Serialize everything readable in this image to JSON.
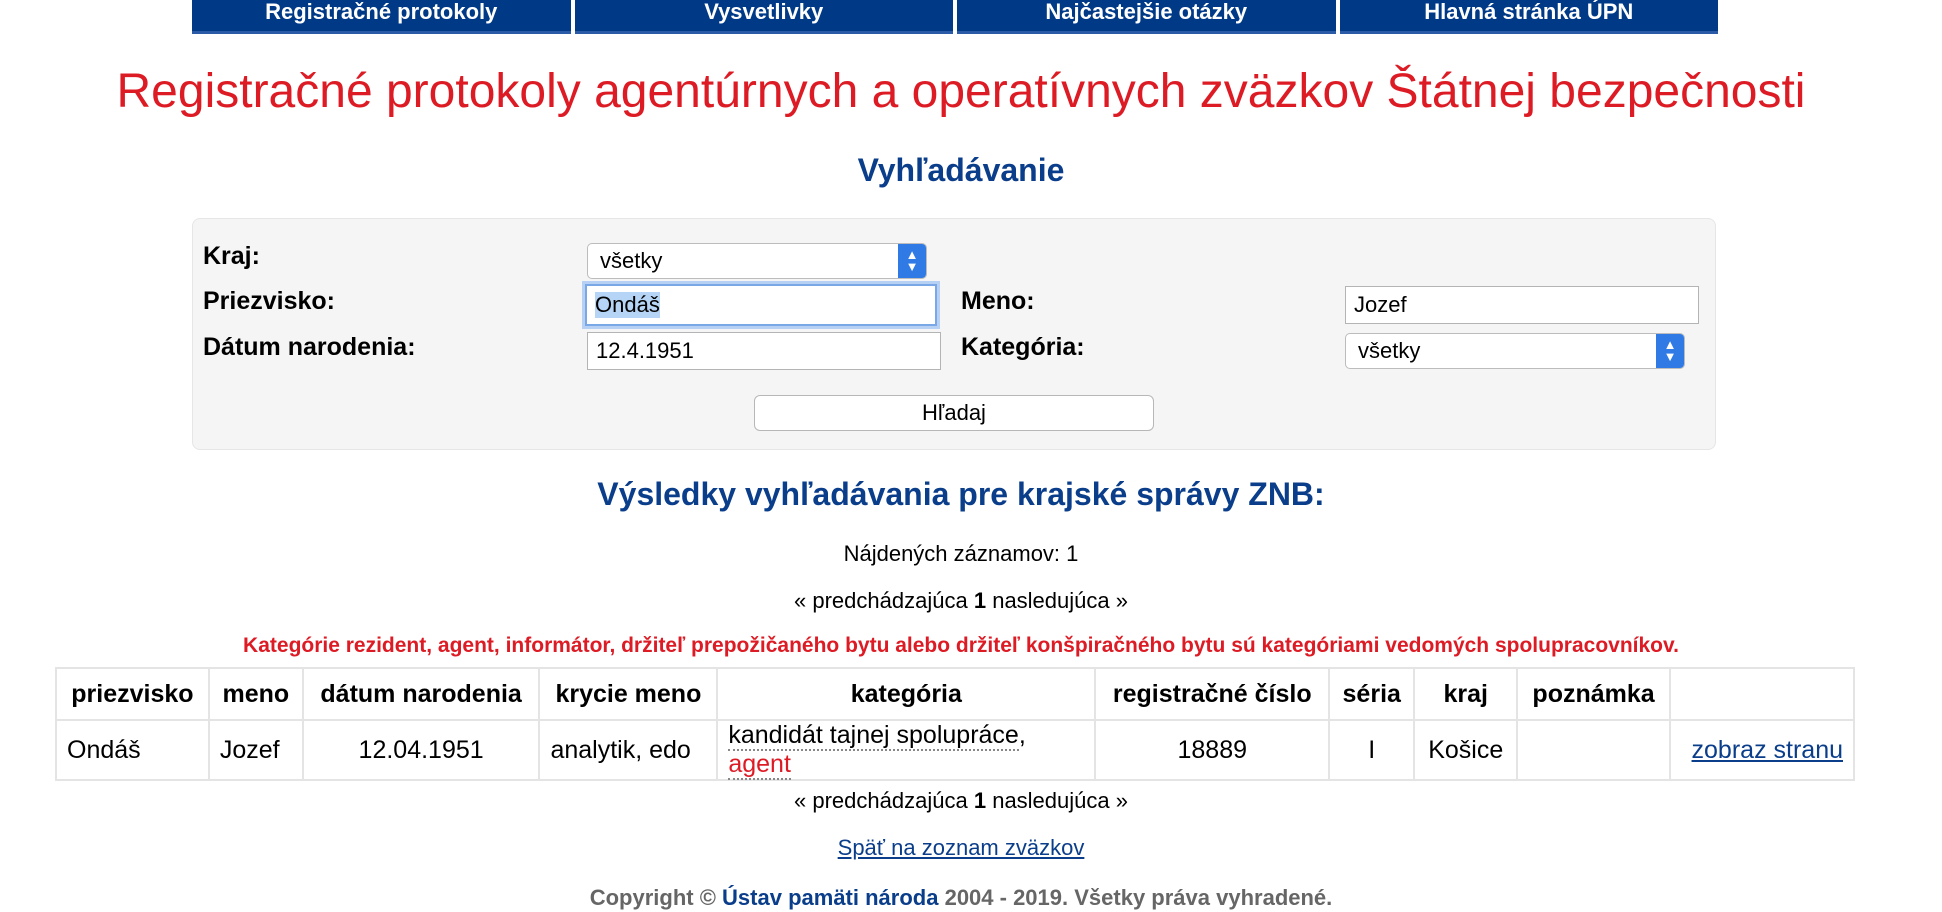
{
  "nav": {
    "items": [
      "Registračné protokoly",
      "Vysvetlivky",
      "Najčastejšie otázky",
      "Hlavná stránka ÚPN"
    ]
  },
  "page_title": "Registračné protokoly agentúrnych a operatívnych zväzkov Štátnej bezpečnosti",
  "search": {
    "title": "Vyhľadávanie",
    "kraj_label": "Kraj:",
    "kraj_value": "všetky",
    "priezvisko_label": "Priezvisko:",
    "priezvisko_value": "Ondáš",
    "meno_label": "Meno:",
    "meno_value": "Jozef",
    "datum_label": "Dátum narodenia:",
    "datum_value": "12.4.1951",
    "kategoria_label": "Kategória:",
    "kategoria_value": "všetky",
    "button_label": "Hľadaj"
  },
  "results": {
    "title": "Výsledky vyhľadávania pre krajské správy ZNB:",
    "count_text": "Nájdených záznamov: 1",
    "pager": {
      "prev": "« predchádzajúca",
      "current": "1",
      "next": "nasledujúca »"
    },
    "warning": "Kategórie rezident, agent, informátor, držiteľ prepožičaného bytu alebo držiteľ konšpiračného bytu sú kategóriami vedomých spolupracovníkov.",
    "columns": [
      "priezvisko",
      "meno",
      "dátum narodenia",
      "krycie meno",
      "kategória",
      "registračné číslo",
      "séria",
      "kraj",
      "poznámka",
      ""
    ],
    "rows": [
      {
        "priezvisko": "Ondáš",
        "meno": "Jozef",
        "datum": "12.04.1951",
        "krycie_meno": "analytik, edo",
        "kategoria_1": "kandidát tajnej spolupráce",
        "kategoria_sep": ", ",
        "kategoria_2": "agent",
        "reg_cislo": "18889",
        "seria": "I",
        "kraj": "Košice",
        "poznamka": "",
        "link": "zobraz stranu"
      }
    ],
    "back_link": "Späť na zoznam zväzkov"
  },
  "footer": {
    "prefix": "Copyright ©",
    "org": "Ústav pamäti národa",
    "suffix": "2004 - 2019. Všetky práva vyhradené."
  },
  "colors": {
    "nav_bg": "#003a87",
    "title_red": "#dd1b24",
    "heading_blue": "#0a3d8a",
    "select_arrow": "#2f7ae5"
  }
}
